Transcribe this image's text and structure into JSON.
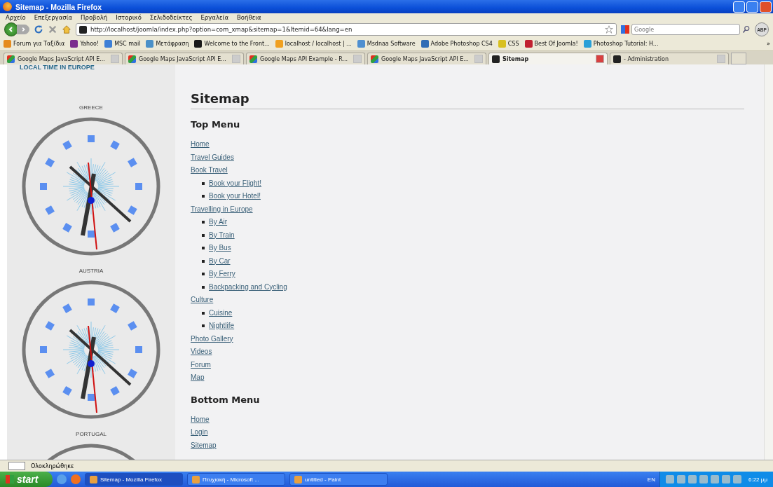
{
  "window": {
    "title": "Sitemap - Mozilla Firefox"
  },
  "menu_bar": [
    "Αρχείο",
    "Επεξεργασία",
    "Προβολή",
    "Ιστορικό",
    "Σελιδοδείκτες",
    "Εργαλεία",
    "Βοήθεια"
  ],
  "nav": {
    "url": "http://localhost/joomla/index.php?option=com_xmap&sitemap=1&Itemid=64&lang=en",
    "search_placeholder": "Google",
    "addon": "ABP"
  },
  "bookmarks": [
    "Forum για Ταξίδια",
    "Yahoo!",
    "MSC mail",
    "Μετάφραση",
    "Welcome to the Front...",
    "localhost / localhost | ...",
    "Msdnaa Software",
    "Adobe Photoshop CS4",
    "CSS",
    "Best Of Joomla!",
    "Photoshop Tutorial: H..."
  ],
  "bookmarks_more": "»",
  "tabs": [
    {
      "label": "Google Maps JavaScript API E...",
      "selected": false
    },
    {
      "label": "Google Maps JavaScript API E...",
      "selected": false
    },
    {
      "label": "Google Maps API Example - R...",
      "selected": false
    },
    {
      "label": "Google Maps JavaScript API E...",
      "selected": false
    },
    {
      "label": "Sitemap",
      "selected": true
    },
    {
      "label": "- Administration",
      "selected": false
    }
  ],
  "sidebar": {
    "heading": "LOCAL TIME IN EUROPE",
    "clocks": [
      "GREECE",
      "AUSTRIA",
      "PORTUGAL"
    ]
  },
  "content": {
    "title": "Sitemap",
    "sections": [
      {
        "heading": "Top Menu",
        "items": [
          {
            "label": "Home"
          },
          {
            "label": "Travel Guides"
          },
          {
            "label": "Book Travel",
            "children": [
              {
                "label": "Book your Flight!"
              },
              {
                "label": "Book your Hotel!"
              }
            ]
          },
          {
            "label": "Travelling in Europe",
            "children": [
              {
                "label": "By Air"
              },
              {
                "label": "By Train"
              },
              {
                "label": "By Bus"
              },
              {
                "label": "By Car"
              },
              {
                "label": "By Ferry"
              },
              {
                "label": "Backpacking and Cycling"
              }
            ]
          },
          {
            "label": "Culture",
            "children": [
              {
                "label": "Cuisine"
              },
              {
                "label": "Nightlife"
              }
            ]
          },
          {
            "label": "Photo Gallery"
          },
          {
            "label": "Videos"
          },
          {
            "label": "Forum"
          },
          {
            "label": "Map"
          }
        ]
      },
      {
        "heading": "Bottom Menu",
        "items": [
          {
            "label": "Home"
          },
          {
            "label": "Login"
          },
          {
            "label": "Sitemap"
          }
        ]
      }
    ]
  },
  "status_bar": {
    "text": "Ολοκληρώθηκε"
  },
  "taskbar": {
    "start": "start",
    "tasks": [
      {
        "label": "Sitemap - Mozilla Firefox",
        "selected": true
      },
      {
        "label": "Πτυχιακή - Microsoft ...",
        "selected": false
      },
      {
        "label": "untitled - Paint",
        "selected": false
      }
    ],
    "language": "EN",
    "time": "6:22 μμ"
  }
}
